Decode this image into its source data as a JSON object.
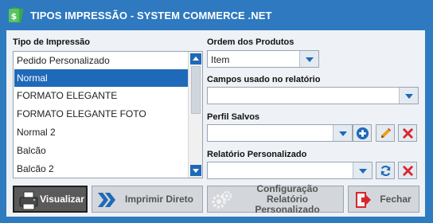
{
  "window": {
    "title": "TIPOS IMPRESSÃO - SYSTEM COMMERCE .NET"
  },
  "tipo_impressao": {
    "label": "Tipo de Impressão",
    "items": [
      "Pedido Personalizado",
      "Normal",
      "FORMATO ELEGANTE",
      "FORMATO ELEGANTE FOTO",
      "Normal 2",
      "Balcão",
      "Balcão 2"
    ],
    "selected": "Normal"
  },
  "ordem_produtos": {
    "label": "Ordem dos Produtos",
    "value": "Item"
  },
  "campos_relatorio": {
    "label": "Campos usado no relatório",
    "value": ""
  },
  "perfil_salvos": {
    "label": "Perfil Salvos",
    "value": ""
  },
  "relatorio_personalizado": {
    "label": "Relatório Personalizado",
    "value": ""
  },
  "buttons": {
    "visualizar": "Visualizar",
    "imprimir_direto": "Imprimir Direto",
    "configuracao": "Configuração Relatório Personalizado",
    "fechar": "Fechar"
  },
  "colors": {
    "titlebar": "#2e79bf",
    "accent": "#1e69b8",
    "delete": "#d9262b",
    "edit": "#e8a317"
  }
}
